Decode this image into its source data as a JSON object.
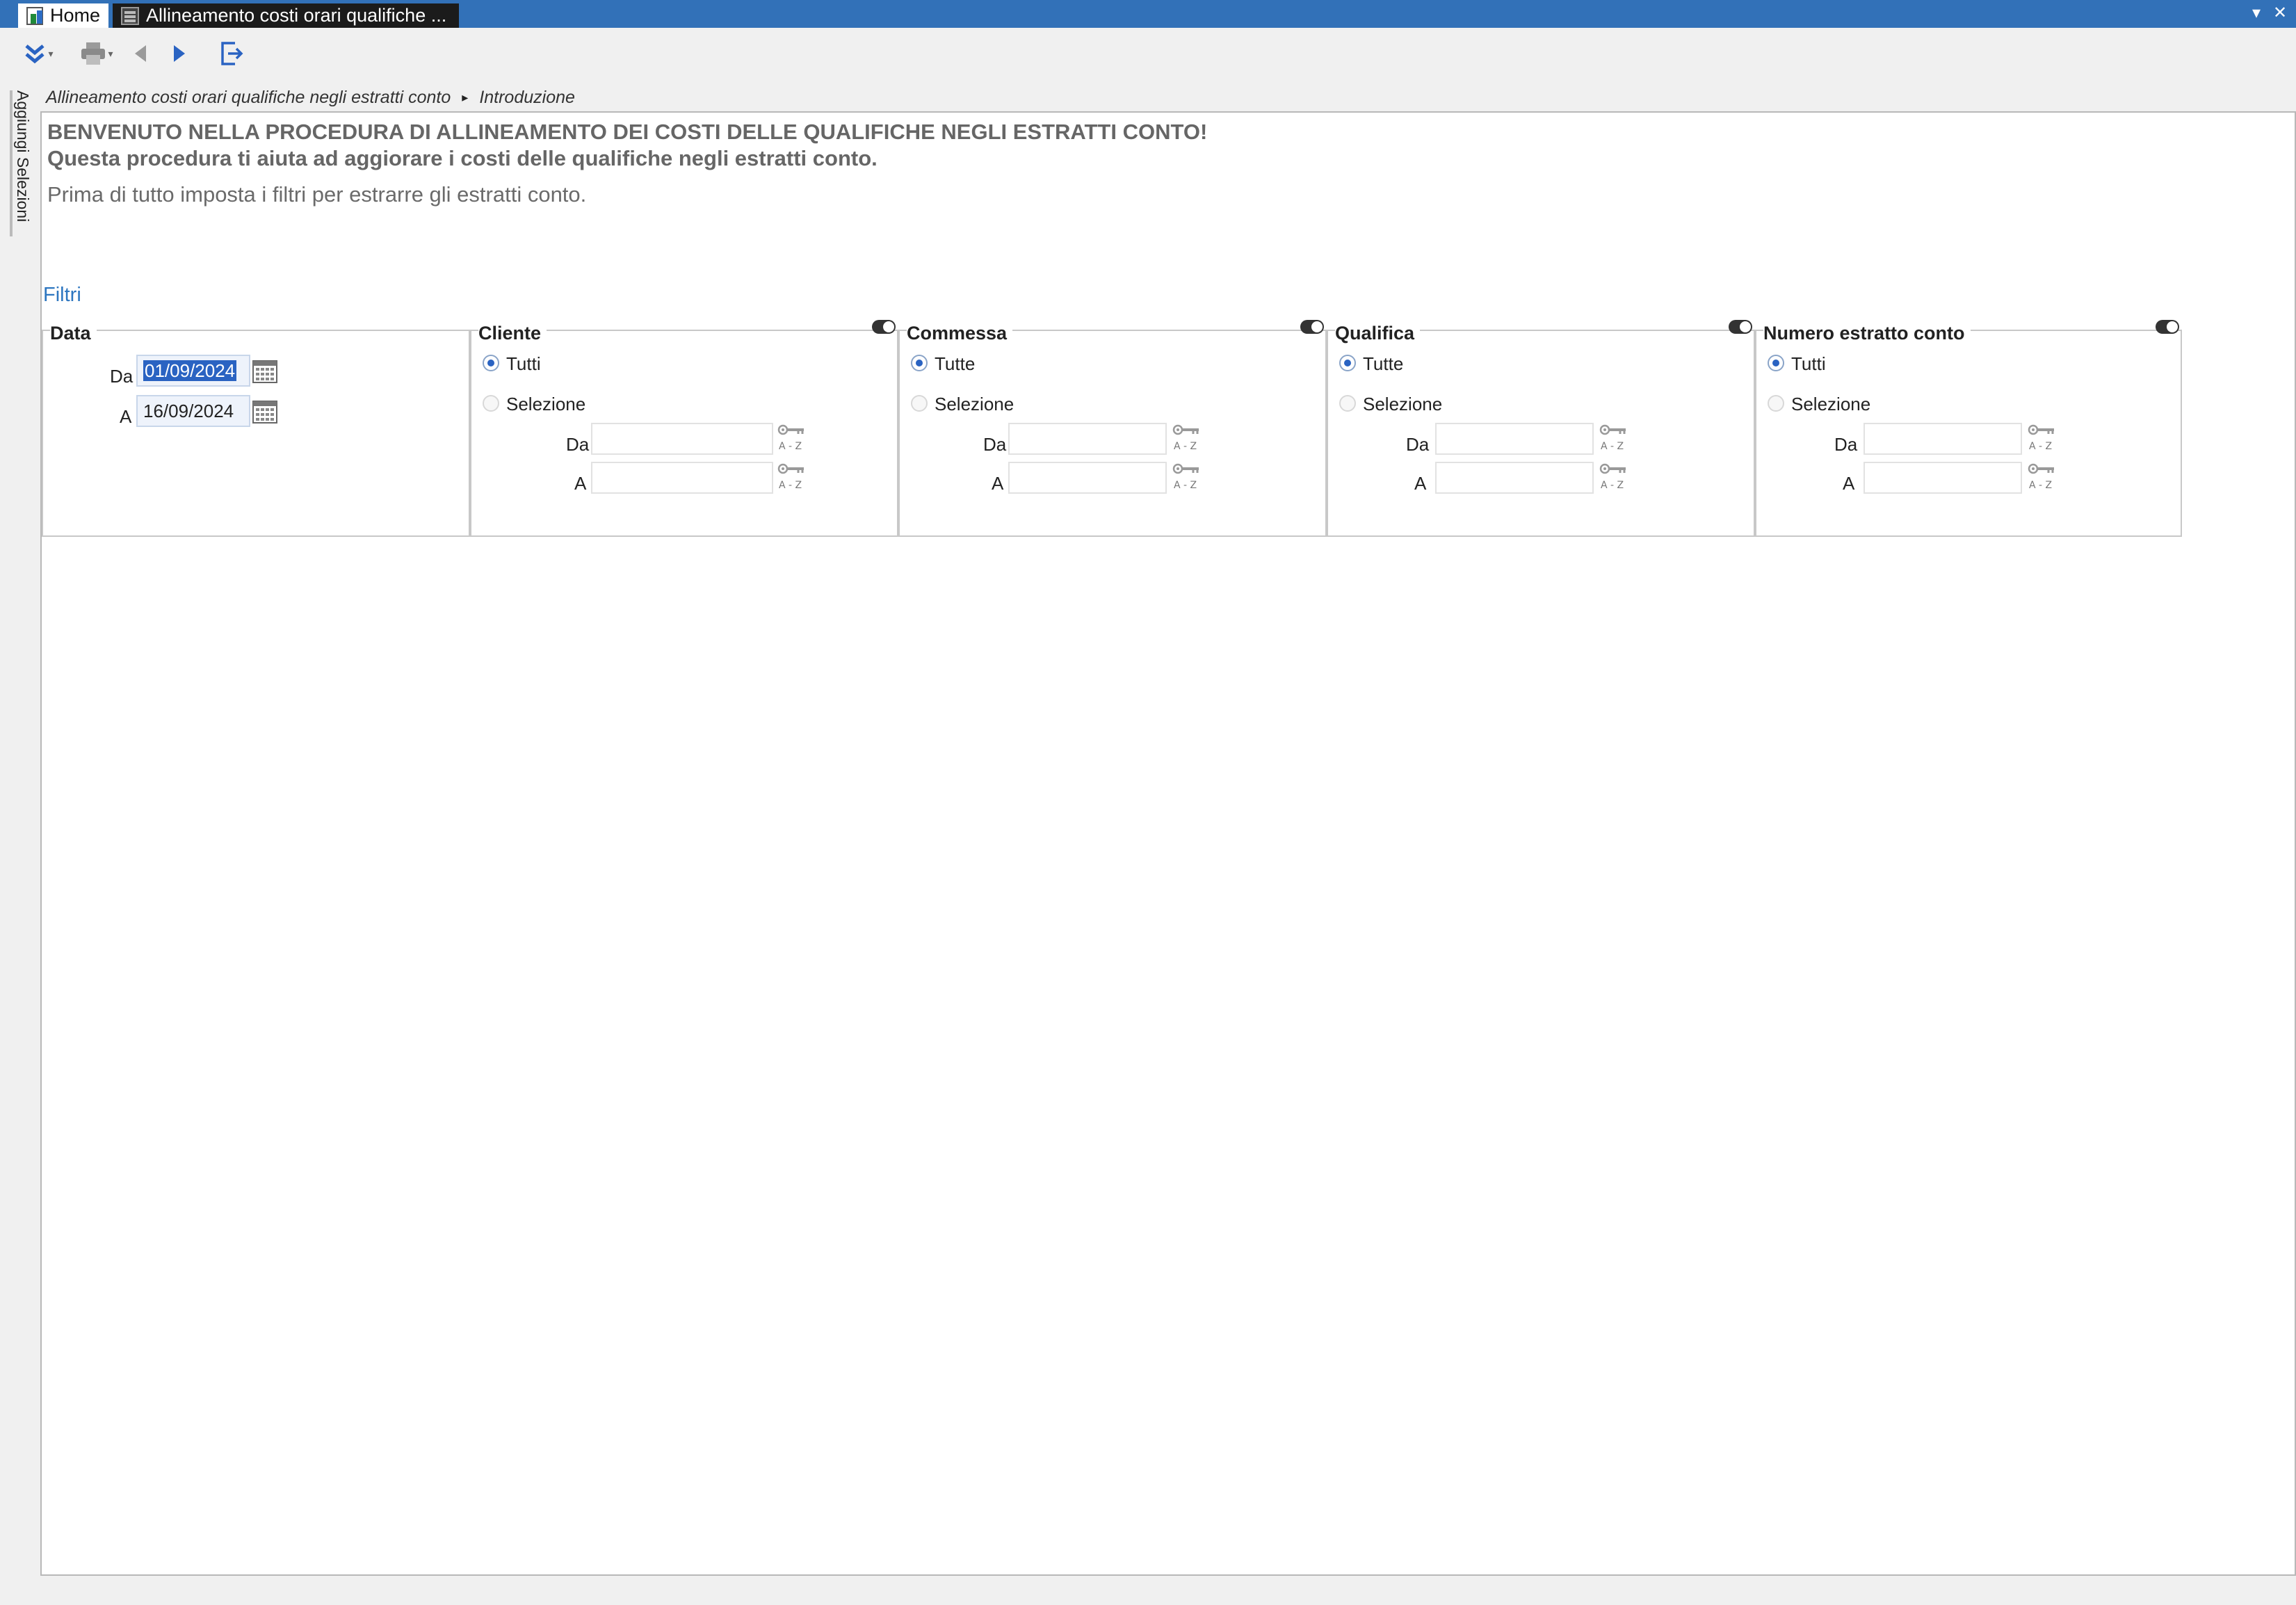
{
  "tabs": {
    "home": "Home",
    "document": "Allineamento costi orari qualifiche ..."
  },
  "window": {
    "minimize": "▾",
    "close": "✕"
  },
  "sidebar": {
    "label": "Aggiungi Selezioni"
  },
  "breadcrumb": {
    "path": "Allineamento costi orari qualifiche negli estratti conto",
    "separator": "▸",
    "current": "Introduzione"
  },
  "intro": {
    "line1": "BENVENUTO NELLA PROCEDURA DI ALLINEAMENTO DEI COSTI DELLE QUALIFICHE NEGLI ESTRATTI CONTO!",
    "line2": "Questa procedura ti aiuta ad aggiorare i costi delle qualifiche negli estratti conto.",
    "line3": "Prima di tutto imposta i filtri per estrarre gli estratti conto."
  },
  "filters": {
    "heading": "Filtri",
    "data": {
      "title": "Data",
      "from_label": "Da",
      "from_value": "01/09/2024",
      "to_label": "A",
      "to_value": "16/09/2024"
    },
    "cliente": {
      "title": "Cliente",
      "opt_all": "Tutti",
      "opt_sel": "Selezione",
      "from_label": "Da",
      "to_label": "A",
      "from_value": "",
      "to_value": ""
    },
    "commessa": {
      "title": "Commessa",
      "opt_all": "Tutte",
      "opt_sel": "Selezione",
      "from_label": "Da",
      "to_label": "A",
      "from_value": "",
      "to_value": ""
    },
    "qualifica": {
      "title": "Qualifica",
      "opt_all": "Tutte",
      "opt_sel": "Selezione",
      "from_label": "Da",
      "to_label": "A",
      "from_value": "",
      "to_value": ""
    },
    "numero": {
      "title": "Numero estratto conto",
      "opt_all": "Tutti",
      "opt_sel": "Selezione",
      "from_label": "Da",
      "to_label": "A",
      "from_value": "",
      "to_value": ""
    },
    "key_caption": "A - Z"
  },
  "colors": {
    "titlebar": "#3271b8",
    "accent": "#2a63c2",
    "heading_gray": "#666666",
    "filtri_blue": "#2d76c0"
  }
}
